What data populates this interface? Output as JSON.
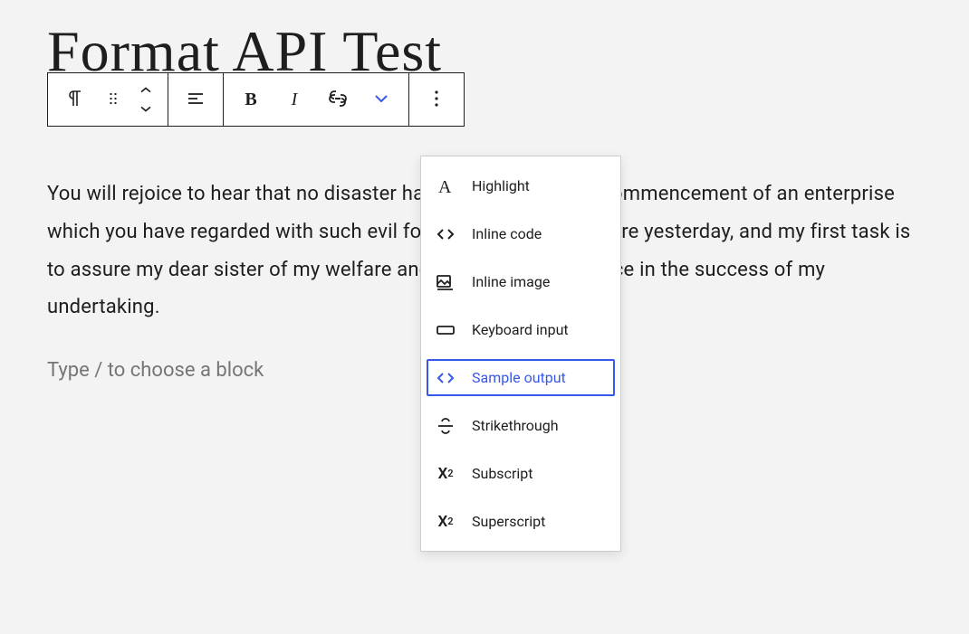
{
  "page": {
    "title": "Format API Test",
    "body": "You will rejoice to hear that no disaster has accompanied the commencement of an enterprise which you have regarded with such evil forebodings. I arrived here yesterday, and my first task is to assure my dear sister of my welfare and increasing confidence in the success of my undertaking.",
    "placeholder": "Type / to choose a block"
  },
  "toolbar": {
    "block_type": "Paragraph",
    "drag": "Drag",
    "move": "Move up/down",
    "align": "Align",
    "bold": "Bold",
    "italic": "Italic",
    "link": "Link",
    "more_rich": "More rich text controls",
    "options": "Options"
  },
  "dropdown": {
    "items": [
      {
        "label": "Highlight",
        "icon": "highlight",
        "selected": false
      },
      {
        "label": "Inline code",
        "icon": "code",
        "selected": false
      },
      {
        "label": "Inline image",
        "icon": "image",
        "selected": false
      },
      {
        "label": "Keyboard input",
        "icon": "keyboard",
        "selected": false
      },
      {
        "label": "Sample output",
        "icon": "code",
        "selected": true
      },
      {
        "label": "Strikethrough",
        "icon": "strikethrough",
        "selected": false
      },
      {
        "label": "Subscript",
        "icon": "subscript",
        "selected": false
      },
      {
        "label": "Superscript",
        "icon": "superscript",
        "selected": false
      }
    ]
  },
  "colors": {
    "accent": "#3858e9"
  }
}
